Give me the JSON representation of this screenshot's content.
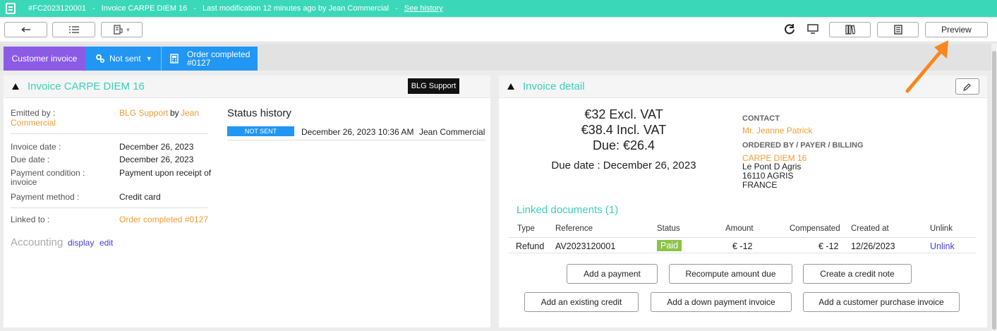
{
  "topbar": {
    "ref": "#FC2023120001",
    "sep": "-",
    "invoice_name": "Invoice CARPE DIEM 16",
    "modification": "Last modification 12 minutes ago by Jean Commercial",
    "history_link": "See history"
  },
  "toolbar": {
    "back_icon": "arrow-back-icon",
    "list_icon": "list-icon",
    "print_icon": "printer-icon",
    "refresh_icon": "refresh-icon",
    "monitor_icon": "monitor-icon",
    "books_icon": "books-icon",
    "archive_icon": "archive-icon",
    "preview_label": "Preview"
  },
  "statusbar": {
    "type_label": "Customer invoice",
    "status_label": "Not sent",
    "order_line1": "Order completed",
    "order_line2": "#0127"
  },
  "left_panel": {
    "title": "Invoice CARPE DIEM 16",
    "badge": "BLG Support",
    "emitted_label": "Emitted by :",
    "emitted_by": "BLG Support",
    "emitted_by_word": "by",
    "emitted_user_1": "Jean",
    "emitted_user_2": "Commercial",
    "invoice_date_label": "Invoice date :",
    "invoice_date": "December 26, 2023",
    "due_date_label": "Due date :",
    "due_date": "December 26, 2023",
    "payment_condition_label_1": "Payment condition :",
    "payment_condition_label_2": "invoice",
    "payment_condition": "Payment upon receipt of",
    "payment_method_label": "Payment method :",
    "payment_method": "Credit card",
    "linked_label": "Linked to :",
    "linked_value": "Order completed #0127",
    "accounting_label": "Accounting",
    "accounting_display": "display",
    "accounting_edit": "edit",
    "history_title": "Status history",
    "history": [
      {
        "status": "NOT SENT",
        "date": "December 26, 2023 10:36 AM",
        "user": "Jean Commercial"
      }
    ]
  },
  "right_panel": {
    "title": "Invoice detail",
    "edit_icon": "pencil-icon",
    "excl_vat": "€32 Excl. VAT",
    "incl_vat": "€38.4 Incl. VAT",
    "due": "Due: €26.4",
    "due_date": "Due date : December 26, 2023",
    "contact_label": "CONTACT",
    "contact_name": "Mr. Jeanne Patrick",
    "ordered_label": "ORDERED BY / PAYER / BILLING",
    "company": "CARPE DIEM 16",
    "address_1": "Le Pont D Agris",
    "address_2": "16110 AGRIS",
    "address_3": "FRANCE",
    "linked_title": "Linked documents (1)",
    "columns": [
      "Type",
      "Reference",
      "Status",
      "Amount",
      "Compensated",
      "Created at",
      "Unlink"
    ],
    "rows": [
      {
        "type": "Refund",
        "reference": "AV2023120001",
        "status": "Paid",
        "amount": "€ -12",
        "compensated": "€ -12",
        "created": "12/26/2023",
        "unlink": "Unlink"
      }
    ],
    "buttons": {
      "add_payment": "Add a payment",
      "recompute": "Recompute amount due",
      "credit_note": "Create a credit note",
      "existing_credit": "Add an existing credit",
      "down_payment": "Add a down payment invoice",
      "purchase_invoice": "Add a customer purchase invoice"
    }
  },
  "colors": {
    "topbar": "#3ad8b8",
    "accent": "#3ad0b8",
    "purple": "#8c5be6",
    "blue": "#2196f3",
    "orange": "#f39c33",
    "paid_green": "#8bc34a",
    "arrow": "#f7871e"
  }
}
